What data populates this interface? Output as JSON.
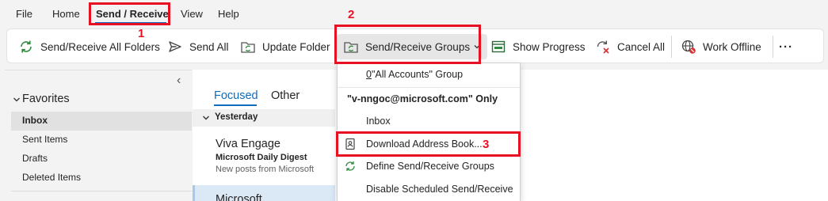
{
  "menubar": {
    "items": [
      "File",
      "Home",
      "Send / Receive",
      "View",
      "Help"
    ]
  },
  "ribbon": {
    "send_receive_all": "Send/Receive All Folders",
    "send_all": "Send All",
    "update_folder": "Update Folder",
    "send_receive_groups": "Send/Receive Groups",
    "show_progress": "Show Progress",
    "cancel_all": "Cancel All",
    "work_offline": "Work Offline",
    "more": "···"
  },
  "nav": {
    "collapse": "‹",
    "favorites": "Favorites",
    "items": [
      "Inbox",
      "Sent Items",
      "Drafts",
      "Deleted Items"
    ]
  },
  "list": {
    "tabs": [
      "Focused",
      "Other"
    ],
    "group_label": "Yesterday",
    "messages": [
      {
        "sender": "Viva Engage",
        "subject": "Microsoft Daily Digest",
        "preview": "New posts from Microsoft"
      },
      {
        "sender": "Microsoft"
      }
    ]
  },
  "dropdown": {
    "group_prefix": "0",
    "group_label": " \"All Accounts\" Group",
    "account_header": "\"v-nngoc@microsoft.com\" Only",
    "inbox": "Inbox",
    "download_address_book": "Download Address Book...",
    "define_groups": "Define Send/Receive Groups",
    "disable_scheduled": "Disable Scheduled Send/Receive"
  },
  "annotations": {
    "step1": "1",
    "step2": "2",
    "step3": "3"
  },
  "colors": {
    "accent": "#0f6cbd",
    "annotation_red": "#e81123",
    "selected_row": "#dbe8f6"
  }
}
